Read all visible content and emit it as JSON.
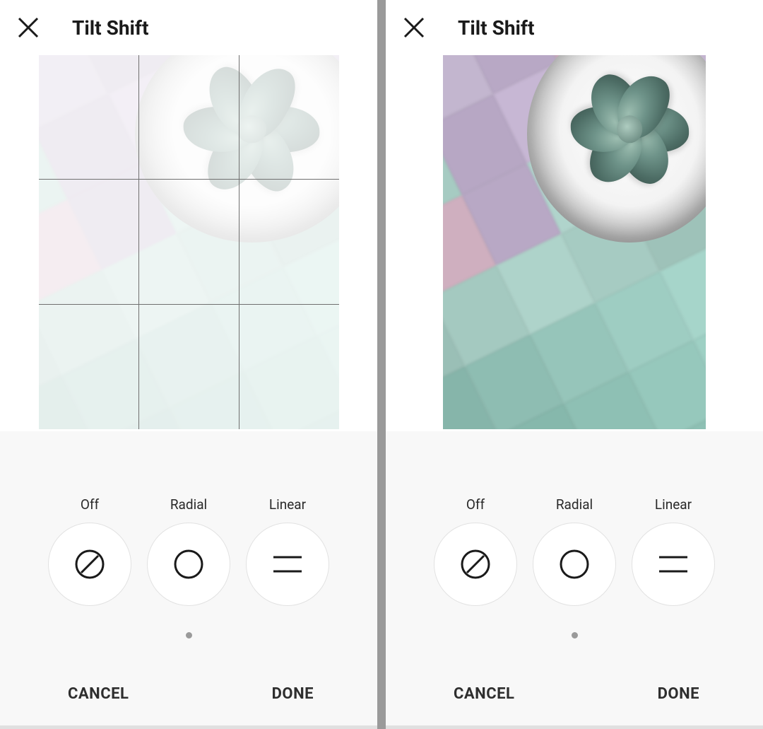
{
  "left": {
    "title": "Tilt Shift",
    "options": {
      "off": "Off",
      "radial": "Radial",
      "linear": "Linear"
    },
    "footer": {
      "cancel": "CANCEL",
      "done": "DONE"
    },
    "grid_visible": true,
    "overlay_wash": true
  },
  "right": {
    "title": "Tilt Shift",
    "options": {
      "off": "Off",
      "radial": "Radial",
      "linear": "Linear"
    },
    "footer": {
      "cancel": "CANCEL",
      "done": "DONE"
    },
    "grid_visible": false,
    "overlay_wash": false
  },
  "tile_colors": [
    "#d9b65c",
    "#e0be63",
    "#d9b65c",
    "#cfa84f",
    "#d09a57",
    "#c79049",
    "#d4c7e0",
    "#c9bdd6",
    "#c3b6cf",
    "#b8a8c5",
    "#c7a8b8",
    "#d0b1c3",
    "#b0d4cc",
    "#a6cbc2",
    "#b7a7c4",
    "#c7b7d4",
    "#d5c5e2",
    "#c4b5d0",
    "#c6a6b6",
    "#cfafbf",
    "#b8a8c5",
    "#b0d4cc",
    "#a6cbc2",
    "#9ec2b9",
    "#9abfb6",
    "#a4c9c0",
    "#aed3ca",
    "#a6cbc2",
    "#9ec2b9",
    "#96b9b0",
    "#86b5aa",
    "#8ebdb2",
    "#96c5ba",
    "#9ecdc2",
    "#a6d5ca",
    "#aeddd2",
    "#7eb0a4",
    "#86b8ac",
    "#8ec0b4",
    "#96c8bc",
    "#9ed0c4",
    "#a6d8cc",
    "#76a89c",
    "#7eb0a4",
    "#86b8ac",
    "#8ec0b4",
    "#96c8bc",
    "#9ed0c4"
  ]
}
